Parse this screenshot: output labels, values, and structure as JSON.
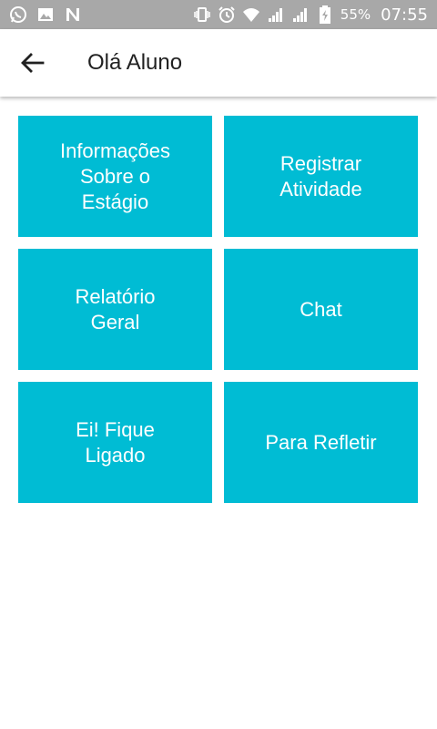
{
  "status_bar": {
    "left_icons": [
      "whatsapp-icon",
      "image-icon",
      "n-app-icon"
    ],
    "right_icons": [
      "vibrate-icon",
      "alarm-icon",
      "wifi-icon",
      "signal-icon",
      "signal-icon-2",
      "battery-icon"
    ],
    "battery_percent": "55%",
    "time": "07:55"
  },
  "app_bar": {
    "back_icon": "arrow-left-icon",
    "title": "Olá Aluno"
  },
  "menu": {
    "tiles": [
      {
        "label": "Informações\nSobre o\nEstágio"
      },
      {
        "label": "Registrar\nAtividade"
      },
      {
        "label": "Relatório Geral"
      },
      {
        "label": "Chat"
      },
      {
        "label": "Ei! Fique\nLigado"
      },
      {
        "label": "Para Refletir"
      }
    ]
  },
  "colors": {
    "tile_background": "#00bcd4",
    "status_bar": "#a8a8a8",
    "app_bar": "#ffffff"
  }
}
